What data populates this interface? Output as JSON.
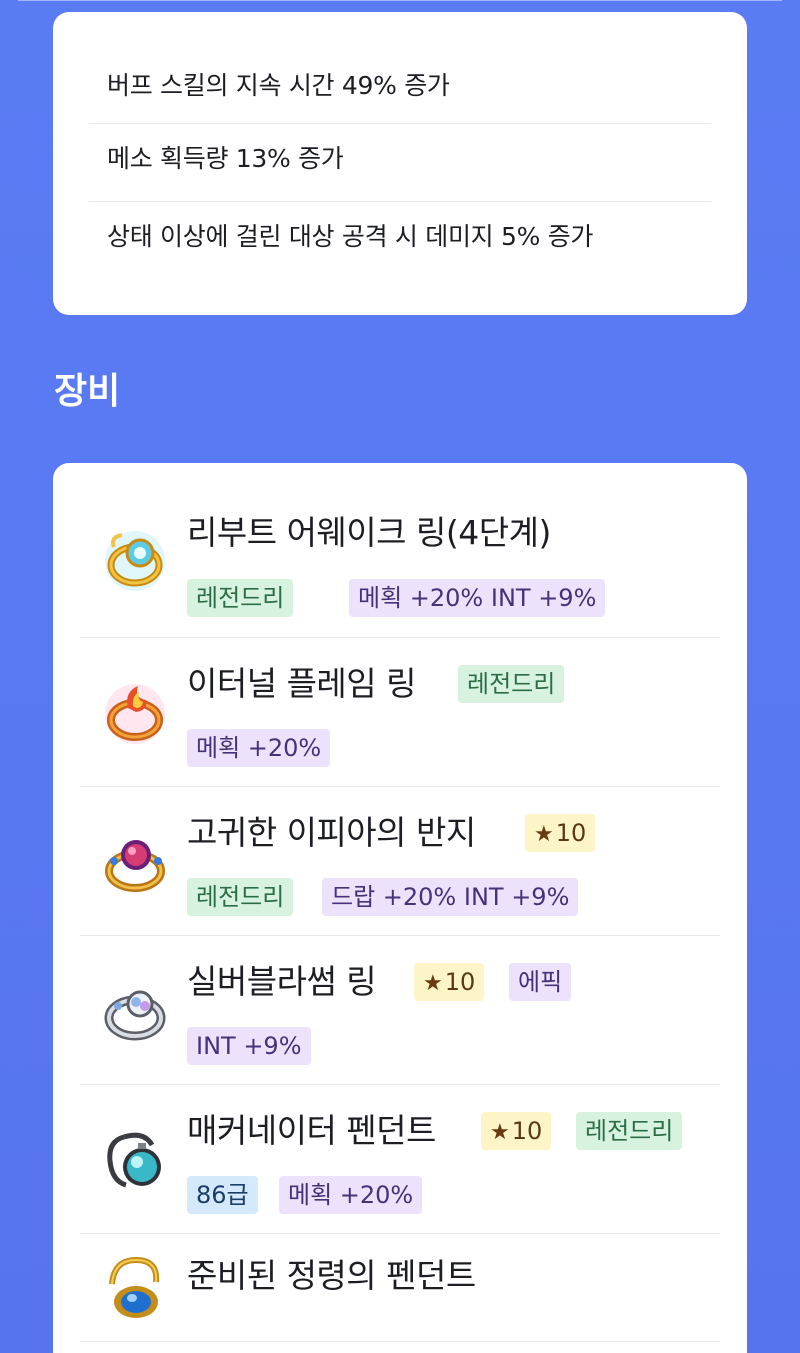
{
  "buffs": [
    "버프 스킬의 지속 시간 49% 증가",
    "메소 획득량 13% 증가",
    "상태 이상에 걸린 대상 공격 시 데미지 5% 증가"
  ],
  "section": {
    "title": "장비"
  },
  "items": [
    {
      "name": "리부트 어웨이크 링(4단계)",
      "icon": "awake-ring-icon",
      "tags": [
        "레전드리",
        "메획 +20% INT +9%"
      ]
    },
    {
      "name": "이터널 플레임 링",
      "icon": "eternal-flame-ring-icon",
      "tags": [
        "레전드리",
        "메획 +20%"
      ]
    },
    {
      "name": "고귀한 이피아의 반지",
      "icon": "ifia-ring-icon",
      "tags": [
        "10",
        "레전드리",
        "드랍 +20% INT +9%"
      ]
    },
    {
      "name": "실버블라썸 링",
      "icon": "silver-blossom-ring-icon",
      "tags": [
        "10",
        "에픽",
        "INT +9%"
      ]
    },
    {
      "name": "매커네이터 펜던트",
      "icon": "mechanator-pendant-icon",
      "tags": [
        "10",
        "레전드리",
        "86급",
        "메획 +20%"
      ]
    },
    {
      "name": "준비된 정령의 펜던트",
      "icon": "spirit-pendant-icon",
      "tags": []
    }
  ],
  "colors": {
    "background": "#5a7cf3",
    "legendary_tag": "#d7f3e0",
    "potential_tag": "#ece2fb",
    "star_tag": "#fdf5c8",
    "grade_tag": "#d4e9fb"
  }
}
